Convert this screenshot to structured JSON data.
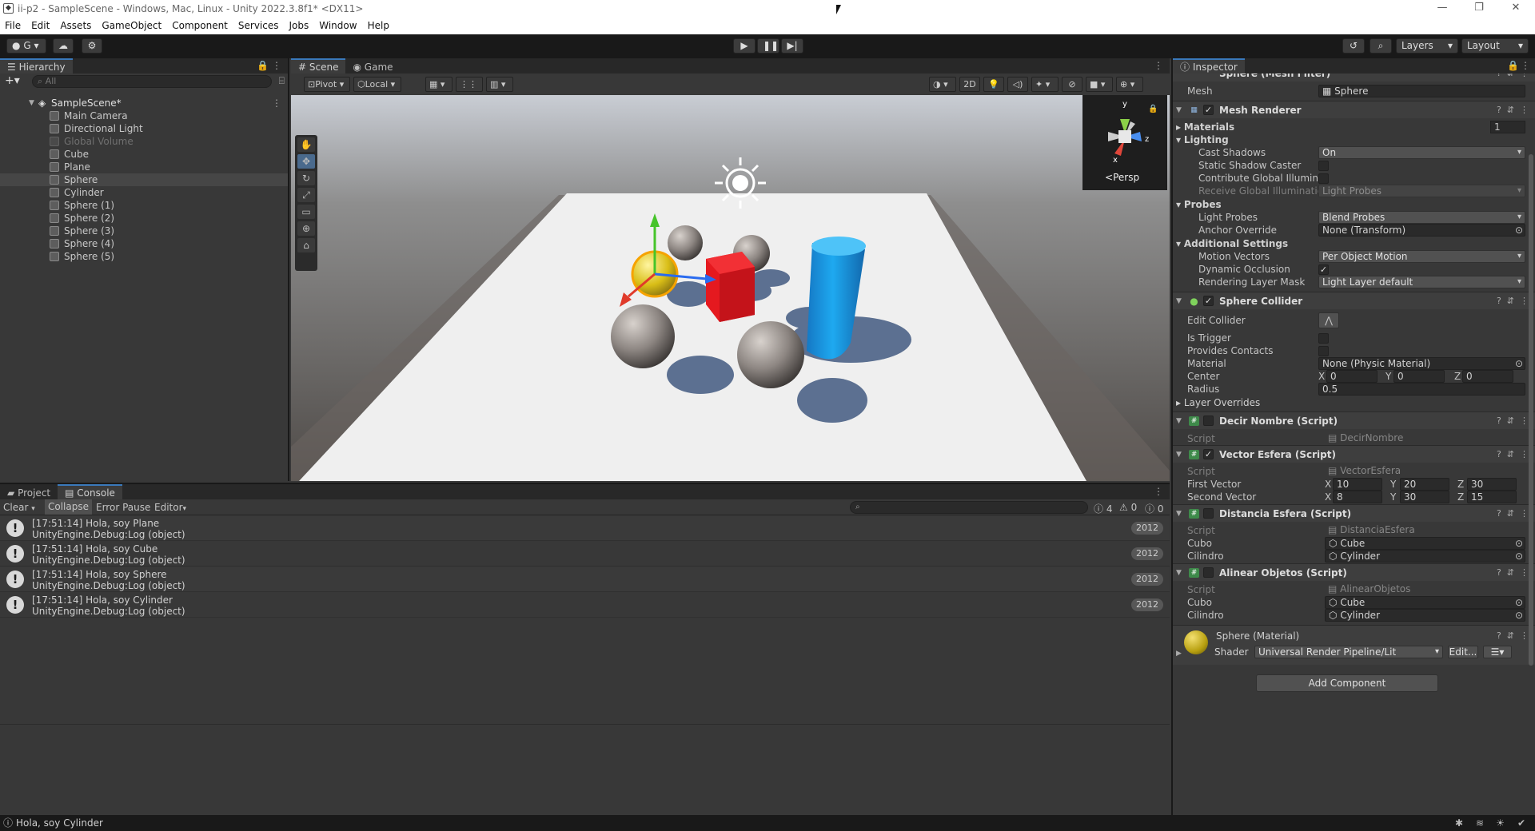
{
  "window": {
    "title": "ii-p2 - SampleScene - Windows, Mac, Linux - Unity 2022.3.8f1* <DX11>",
    "minimize": "—",
    "maximize": "❐",
    "close": "✕"
  },
  "menu": [
    "File",
    "Edit",
    "Assets",
    "GameObject",
    "Component",
    "Services",
    "Jobs",
    "Window",
    "Help"
  ],
  "toolbar": {
    "account_label": "G",
    "layers_label": "Layers",
    "layout_label": "Layout"
  },
  "hierarchy": {
    "tab": "Hierarchy",
    "search_placeholder": "All",
    "scene_name": "SampleScene*",
    "items": [
      "Main Camera",
      "Directional Light",
      "Global Volume",
      "Cube",
      "Plane",
      "Sphere",
      "Cylinder",
      "Sphere (1)",
      "Sphere (2)",
      "Sphere (3)",
      "Sphere (4)",
      "Sphere (5)"
    ]
  },
  "scene_view": {
    "tab_scene": "Scene",
    "tab_game": "Game",
    "pivot": "Pivot",
    "local": "Local",
    "mode_2d": "2D",
    "persp": "Persp",
    "gizmo_y": "y",
    "gizmo_z": "z",
    "gizmo_x": "x"
  },
  "console": {
    "tab_project": "Project",
    "tab_console": "Console",
    "clear": "Clear",
    "collapse": "Collapse",
    "error_pause": "Error Pause",
    "editor": "Editor",
    "count_log": "4",
    "count_warn": "0",
    "count_err": "0",
    "rows": [
      {
        "line1": "[17:51:14] Hola, soy Plane",
        "line2": "UnityEngine.Debug:Log (object)",
        "count": "2012"
      },
      {
        "line1": "[17:51:14] Hola, soy Cube",
        "line2": "UnityEngine.Debug:Log (object)",
        "count": "2012"
      },
      {
        "line1": "[17:51:14] Hola, soy Sphere",
        "line2": "UnityEngine.Debug:Log (object)",
        "count": "2012"
      },
      {
        "line1": "[17:51:14] Hola, soy Cylinder",
        "line2": "UnityEngine.Debug:Log (object)",
        "count": "2012"
      }
    ]
  },
  "inspector": {
    "tab": "Inspector",
    "mesh_filter_title": "Sphere (Mesh Filter)",
    "mesh_label": "Mesh",
    "mesh_value": "Sphere",
    "mesh_renderer": {
      "title": "Mesh Renderer",
      "materials": "Materials",
      "materials_count": "1",
      "lighting": "Lighting",
      "cast_shadows": "Cast Shadows",
      "cast_shadows_value": "On",
      "static_shadow_caster": "Static Shadow Caster",
      "contribute_gi": "Contribute Global Illumina",
      "receive_gi": "Receive Global Illuminatic",
      "receive_gi_value": "Light Probes",
      "probes": "Probes",
      "light_probes": "Light Probes",
      "light_probes_value": "Blend Probes",
      "anchor_override": "Anchor Override",
      "anchor_override_value": "None (Transform)",
      "additional_settings": "Additional Settings",
      "motion_vectors": "Motion Vectors",
      "motion_vectors_value": "Per Object Motion",
      "dynamic_occlusion": "Dynamic Occlusion",
      "rendering_layer_mask": "Rendering Layer Mask",
      "rendering_layer_mask_value": "Light Layer default"
    },
    "sphere_collider": {
      "title": "Sphere Collider",
      "edit_collider": "Edit Collider",
      "is_trigger": "Is Trigger",
      "provides_contacts": "Provides Contacts",
      "material": "Material",
      "material_value": "None (Physic Material)",
      "center": "Center",
      "center_x": "0",
      "center_y": "0",
      "center_z": "0",
      "radius": "Radius",
      "radius_value": "0.5",
      "layer_overrides": "Layer Overrides"
    },
    "decir_nombre": {
      "title": "Decir Nombre (Script)",
      "script": "Script",
      "script_value": "DecirNombre"
    },
    "vector_esfera": {
      "title": "Vector Esfera (Script)",
      "script": "Script",
      "script_value": "VectorEsfera",
      "first_vector": "First Vector",
      "fv_x": "10",
      "fv_y": "20",
      "fv_z": "30",
      "second_vector": "Second Vector",
      "sv_x": "8",
      "sv_y": "30",
      "sv_z": "15"
    },
    "distancia_esfera": {
      "title": "Distancia Esfera (Script)",
      "script": "Script",
      "script_value": "DistanciaEsfera",
      "cubo": "Cubo",
      "cubo_value": "Cube",
      "cilindro": "Cilindro",
      "cilindro_value": "Cylinder"
    },
    "alinear_objetos": {
      "title": "Alinear Objetos (Script)",
      "script": "Script",
      "script_value": "AlinearObjetos",
      "cubo": "Cubo",
      "cubo_value": "Cube",
      "cilindro": "Cilindro",
      "cilindro_value": "Cylinder"
    },
    "material": {
      "title": "Sphere (Material)",
      "shader_label": "Shader",
      "shader_value": "Universal Render Pipeline/Lit",
      "edit": "Edit..."
    },
    "add_component": "Add Component",
    "xyz": {
      "x": "X",
      "y": "Y",
      "z": "Z"
    }
  },
  "status": {
    "message": "Hola, soy Cylinder"
  },
  "colors": {
    "accent": "#3a79bb",
    "panel": "#383838",
    "sphere_selected": "#e3c51a",
    "cube": "#e5191f",
    "cylinder": "#1aa0e8"
  }
}
